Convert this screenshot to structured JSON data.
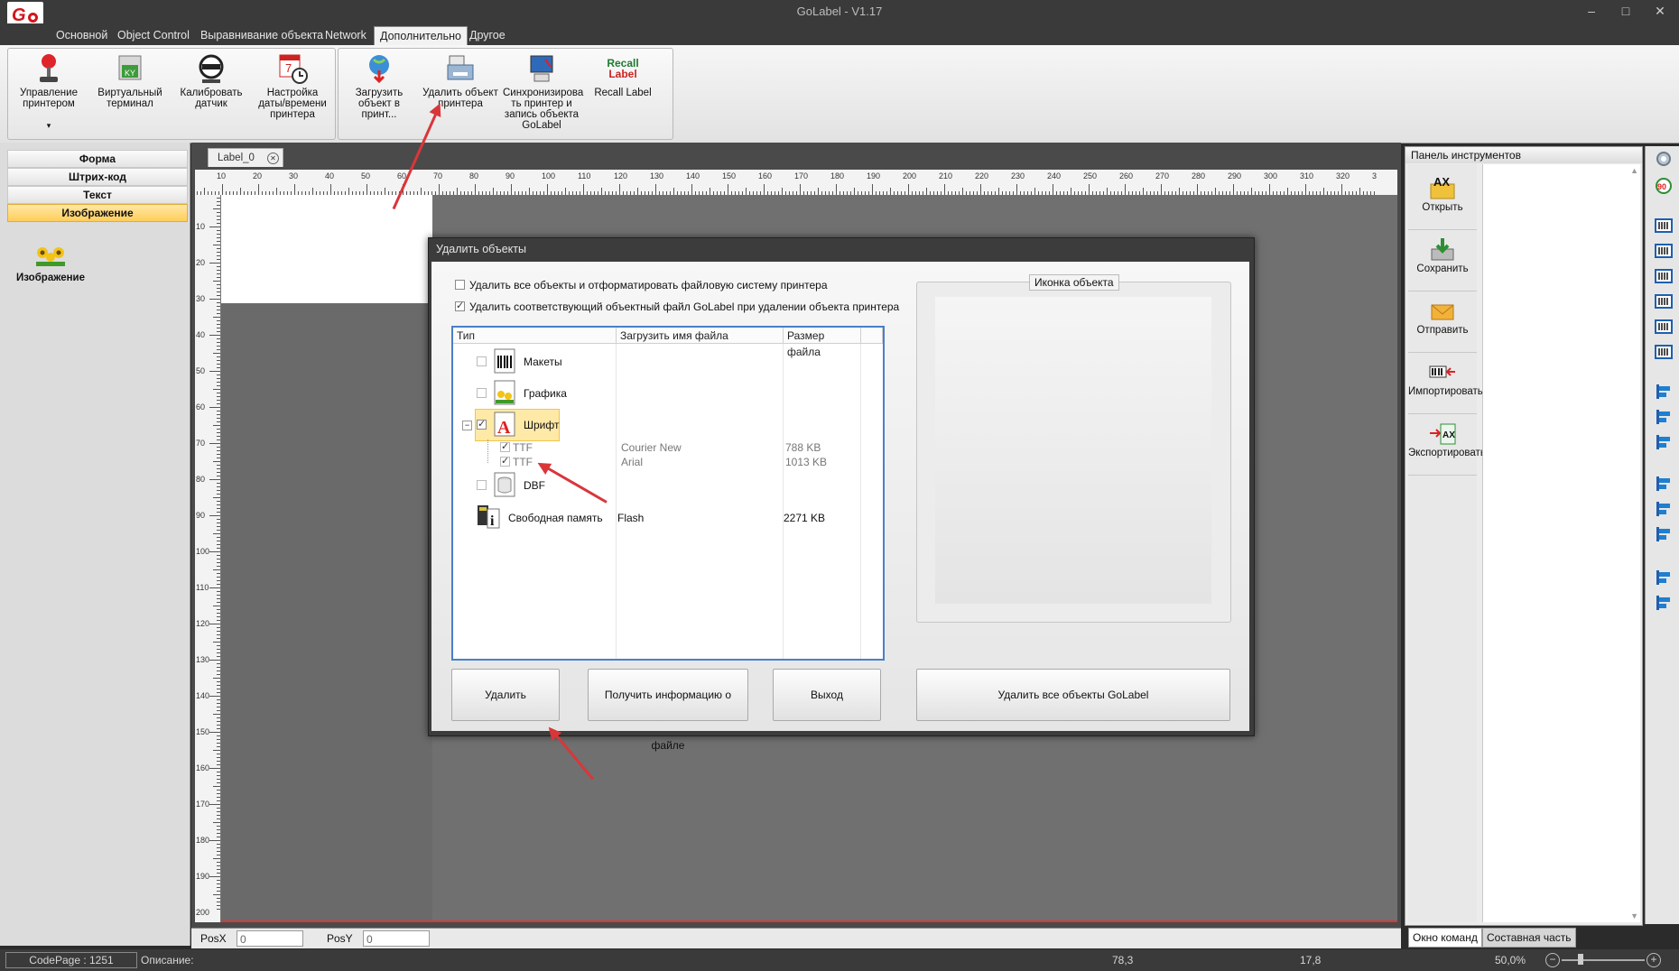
{
  "window": {
    "title": "GoLabel - V1.17"
  },
  "tabs": [
    "Основной",
    "Object Control",
    "Выравнивание объекта",
    "Network",
    "Дополнительно",
    "Другое"
  ],
  "ribbon": {
    "printer_manage": "Управление принтером",
    "virtual_terminal": "Виртуальный терминал",
    "calibrate_sensor": "Калибровать датчик",
    "set_datetime": "Настройка даты/времени принтера",
    "download_object": "Загрузить объект в принт...",
    "delete_object": "Удалить объект принтера",
    "sync_printer": "Синхронизирова ть принтер и запись объекта GoLabel",
    "recall_label": "Recall Label",
    "recall_icon_text1": "Recall",
    "recall_icon_text2": "Label"
  },
  "left_panel": {
    "items": [
      "Форма",
      "Штрих-код",
      "Текст",
      "Изображение"
    ],
    "image_item": "Изображение"
  },
  "document": {
    "tab": "Label_0",
    "unit": "mm",
    "h_ticks": [
      "10",
      "20",
      "30",
      "40",
      "50",
      "60",
      "70",
      "80",
      "90",
      "100",
      "110",
      "120",
      "130",
      "140",
      "150",
      "160",
      "170",
      "180",
      "190",
      "200",
      "210",
      "220",
      "230",
      "240",
      "250",
      "260",
      "270",
      "280",
      "290",
      "300",
      "310",
      "320",
      "3"
    ],
    "v_ticks": [
      "10",
      "20",
      "30",
      "40",
      "50",
      "60",
      "70",
      "80",
      "90",
      "100",
      "110",
      "120",
      "130",
      "140",
      "150",
      "160",
      "170",
      "180",
      "190",
      "200"
    ]
  },
  "posbar": {
    "posx_label": "PosX",
    "posx_value": "0",
    "posy_label": "PosY",
    "posy_value": "0"
  },
  "tool_panel": {
    "title": "Панель инструментов",
    "open": "Открыть",
    "save": "Сохранить",
    "send": "Отправить",
    "import": "Импортировать",
    "export": "Экспортировать",
    "tab_commands": "Окно команд",
    "tab_component": "Составная часть"
  },
  "status": {
    "codepage": "CodePage : 1251",
    "description": "Описание:",
    "x": "78,3",
    "y": "17,8",
    "zoom": "50,0%"
  },
  "dialog": {
    "title": "Удалить объекты",
    "option_format": "Удалить все объекты и отформатировать файловую систему принтера",
    "option_delete_file": "Удалить соответствующий объектный файл GoLabel при удалении объекта принтера",
    "columns": [
      "Тип",
      "Загрузить имя файла",
      "Размер файла"
    ],
    "rows": {
      "layouts": "Макеты",
      "graphics": "Графика",
      "font": "Шрифт",
      "ttf1_type": "TTF",
      "ttf1_name": "Courier New",
      "ttf1_size": "788 KB",
      "ttf2_type": "TTF",
      "ttf2_name": "Arial",
      "ttf2_size": "1013 KB",
      "dbf": "DBF",
      "free_memory": "Свободная память",
      "free_memory_name": "Flash",
      "free_memory_size": "2271 KB"
    },
    "icon_group": "Иконка объекта",
    "buttons": {
      "delete": "Удалить",
      "get_info": "Получить информацию о файле",
      "exit": "Выход",
      "delete_all": "Удалить все объекты GoLabel"
    }
  },
  "colors": {
    "accent": "#ffce5a",
    "arrow": "#d9363a",
    "selection_border": "#4a7fc8"
  }
}
